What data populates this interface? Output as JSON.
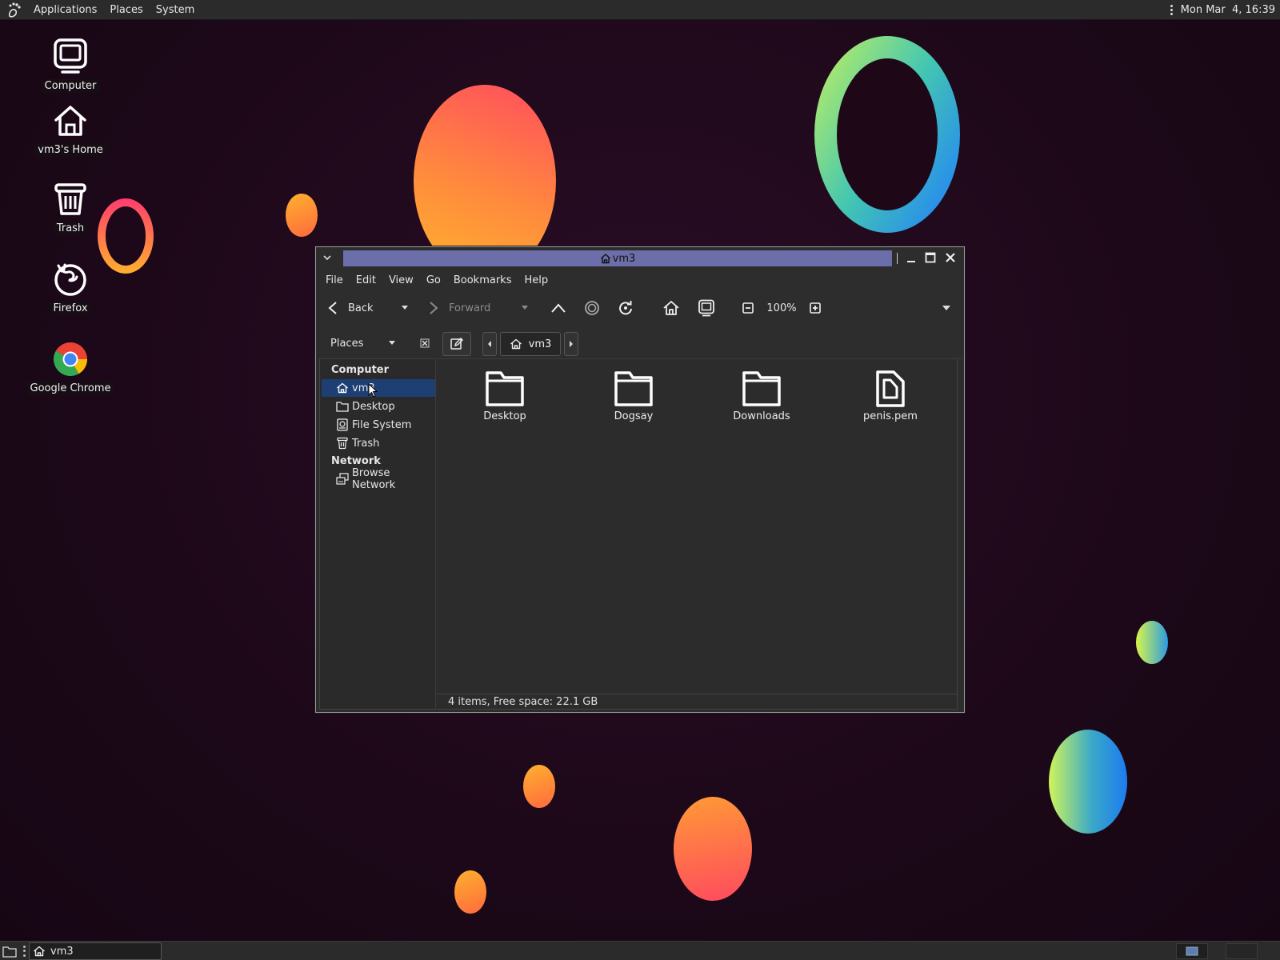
{
  "top_panel": {
    "menus": [
      "Applications",
      "Places",
      "System"
    ],
    "clock": "Mon Mar  4, 16:39"
  },
  "desktop": {
    "icons": [
      {
        "label": "Computer",
        "icon": "computer-icon"
      },
      {
        "label": "vm3's Home",
        "icon": "home-icon"
      },
      {
        "label": "Trash",
        "icon": "trash-icon"
      },
      {
        "label": "Firefox",
        "icon": "firefox-icon"
      },
      {
        "label": "Google Chrome",
        "icon": "chrome-icon"
      }
    ]
  },
  "window": {
    "title": "vm3",
    "menubar": [
      "File",
      "Edit",
      "View",
      "Go",
      "Bookmarks",
      "Help"
    ],
    "toolbar": {
      "back": "Back",
      "forward": "Forward",
      "zoom": "100%"
    },
    "location": {
      "places_label": "Places",
      "crumb": "vm3"
    },
    "sidebar": {
      "sections": [
        {
          "heading": "Computer",
          "items": [
            {
              "label": "vm3",
              "icon": "home-icon",
              "selected": true
            },
            {
              "label": "Desktop",
              "icon": "folder-icon"
            },
            {
              "label": "File System",
              "icon": "drive-icon"
            },
            {
              "label": "Trash",
              "icon": "trash-icon"
            }
          ]
        },
        {
          "heading": "Network",
          "items": [
            {
              "label": "Browse Network",
              "icon": "network-icon"
            }
          ]
        }
      ]
    },
    "files": [
      {
        "name": "Desktop",
        "icon": "folder-icon"
      },
      {
        "name": "Dogsay",
        "icon": "folder-icon"
      },
      {
        "name": "Downloads",
        "icon": "folder-icon"
      },
      {
        "name": "penis.pem",
        "icon": "file-icon"
      }
    ],
    "status": "4 items, Free space: 22.1 GB"
  },
  "bottom_panel": {
    "task": "vm3"
  },
  "colors": {
    "title_field": "#6b6ea8",
    "selection": "#1d3f73",
    "panel": "#2b2b2b"
  }
}
